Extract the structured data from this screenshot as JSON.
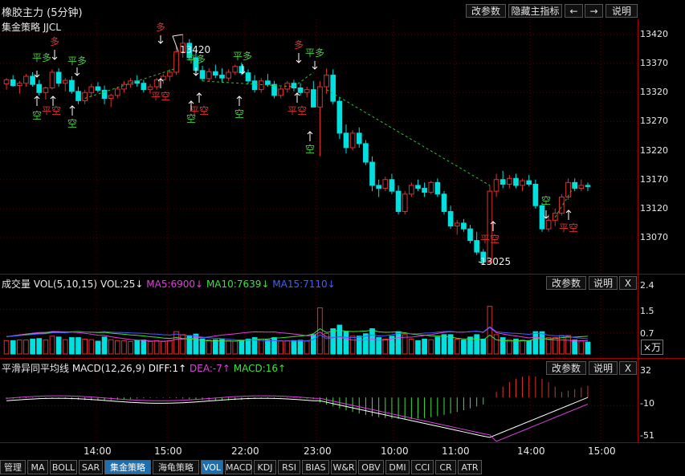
{
  "header": {
    "title": "橡胶主力 (5分钟)",
    "buttons": [
      "改参数",
      "隐藏主指标",
      "←",
      "→",
      "说明"
    ]
  },
  "main_panel": {
    "strategy_label": "集金策略 JJCL",
    "price_ticks": [
      "13420",
      "13370",
      "13320",
      "13270",
      "13220",
      "13170",
      "13120",
      "13070"
    ],
    "high_label": "13420",
    "low_label": "13025",
    "signals": {
      "long": "多",
      "close_long": "平多",
      "short": "空",
      "close_short": "平空"
    }
  },
  "volume_panel": {
    "name": "成交量 VOL(5,10,15)",
    "vol": "VOL:25↓",
    "ma5": "MA5:6900↓",
    "ma10": "MA10:7639↓",
    "ma15": "MA15:7110↓",
    "ticks": [
      "2.4",
      "1.5",
      "0.7"
    ],
    "unit": "×万",
    "buttons": [
      "改参数",
      "说明",
      "X"
    ]
  },
  "macd_panel": {
    "name": "平滑异同平均线 MACD(12,26,9)",
    "diff": "DIFF:1↑",
    "dea": "DEA:-7↑",
    "macd": "MACD:16↑",
    "ticks": [
      "32",
      "-10",
      "-51"
    ],
    "buttons": [
      "改参数",
      "说明",
      "X"
    ]
  },
  "time_axis": [
    "14:00",
    "15:00",
    "22:00",
    "23:00",
    "10:00",
    "11:00",
    "14:00",
    "15:00"
  ],
  "bottom_tabs": [
    "管理",
    "MA",
    "BOLL",
    "SAR",
    "集金策略",
    "海龟策略",
    "VOL",
    "MACD",
    "KDJ",
    "RSI",
    "BIAS",
    "W&R",
    "OBV",
    "DMI",
    "CCI",
    "CR",
    "ATR"
  ],
  "active_tabs": [
    "集金策略",
    "VOL"
  ],
  "colors": {
    "up": "#e03030",
    "down": "#00e0e0",
    "accent_tab": "#1e6fb0",
    "ma5": "#e040e0",
    "ma10": "#40e040",
    "ma15": "#4060ff",
    "diff": "#ffffff",
    "dea": "#e040e0",
    "signal_green": "#40d040",
    "signal_red": "#e03030"
  },
  "chart_data": {
    "type": "candlestick",
    "title": "橡胶主力 (5分钟)",
    "ylim": [
      13025,
      13420
    ],
    "candles": [
      [
        13335,
        13345,
        13325,
        13342
      ],
      [
        13342,
        13350,
        13330,
        13332
      ],
      [
        13332,
        13340,
        13318,
        13336
      ],
      [
        13336,
        13352,
        13330,
        13348
      ],
      [
        13348,
        13355,
        13330,
        13334
      ],
      [
        13334,
        13342,
        13315,
        13320
      ],
      [
        13320,
        13330,
        13308,
        13328
      ],
      [
        13328,
        13360,
        13325,
        13355
      ],
      [
        13355,
        13362,
        13330,
        13336
      ],
      [
        13336,
        13345,
        13322,
        13341
      ],
      [
        13341,
        13348,
        13318,
        13322
      ],
      [
        13322,
        13330,
        13300,
        13306
      ],
      [
        13306,
        13325,
        13300,
        13320
      ],
      [
        13320,
        13335,
        13312,
        13330
      ],
      [
        13330,
        13338,
        13320,
        13324
      ],
      [
        13324,
        13332,
        13300,
        13310
      ],
      [
        13310,
        13318,
        13295,
        13315
      ],
      [
        13315,
        13330,
        13310,
        13326
      ],
      [
        13326,
        13340,
        13320,
        13334
      ],
      [
        13334,
        13345,
        13328,
        13340
      ],
      [
        13340,
        13350,
        13330,
        13336
      ],
      [
        13336,
        13342,
        13320,
        13325
      ],
      [
        13325,
        13335,
        13318,
        13330
      ],
      [
        13330,
        13345,
        13325,
        13342
      ],
      [
        13342,
        13352,
        13335,
        13348
      ],
      [
        13348,
        13360,
        13340,
        13355
      ],
      [
        13355,
        13400,
        13350,
        13390
      ],
      [
        13390,
        13420,
        13380,
        13405
      ],
      [
        13405,
        13412,
        13375,
        13380
      ],
      [
        13380,
        13392,
        13350,
        13358
      ],
      [
        13358,
        13366,
        13340,
        13344
      ],
      [
        13344,
        13362,
        13340,
        13356
      ],
      [
        13356,
        13368,
        13345,
        13350
      ],
      [
        13350,
        13362,
        13338,
        13345
      ],
      [
        13345,
        13360,
        13340,
        13355
      ],
      [
        13355,
        13368,
        13350,
        13365
      ],
      [
        13365,
        13372,
        13350,
        13354
      ],
      [
        13354,
        13360,
        13335,
        13340
      ],
      [
        13340,
        13350,
        13320,
        13325
      ],
      [
        13325,
        13345,
        13320,
        13340
      ],
      [
        13340,
        13352,
        13330,
        13334
      ],
      [
        13334,
        13340,
        13310,
        13315
      ],
      [
        13315,
        13330,
        13310,
        13326
      ],
      [
        13326,
        13340,
        13320,
        13336
      ],
      [
        13336,
        13342,
        13322,
        13328
      ],
      [
        13328,
        13336,
        13315,
        13320
      ],
      [
        13320,
        13330,
        13312,
        13325
      ],
      [
        13325,
        13340,
        13300,
        13295
      ],
      [
        13295,
        13340,
        13210,
        13330
      ],
      [
        13330,
        13362,
        13318,
        13350
      ],
      [
        13350,
        13360,
        13300,
        13305
      ],
      [
        13305,
        13312,
        13240,
        13250
      ],
      [
        13250,
        13265,
        13215,
        13225
      ],
      [
        13225,
        13255,
        13220,
        13250
      ],
      [
        13250,
        13260,
        13225,
        13232
      ],
      [
        13232,
        13238,
        13195,
        13200
      ],
      [
        13200,
        13210,
        13150,
        13160
      ],
      [
        13160,
        13170,
        13140,
        13155
      ],
      [
        13155,
        13175,
        13150,
        13170
      ],
      [
        13170,
        13180,
        13145,
        13150
      ],
      [
        13150,
        13160,
        13110,
        13115
      ],
      [
        13115,
        13150,
        13110,
        13145
      ],
      [
        13145,
        13165,
        13140,
        13160
      ],
      [
        13160,
        13170,
        13150,
        13155
      ],
      [
        13155,
        13165,
        13140,
        13148
      ],
      [
        13148,
        13168,
        13145,
        13165
      ],
      [
        13165,
        13172,
        13140,
        13145
      ],
      [
        13145,
        13150,
        13110,
        13115
      ],
      [
        13115,
        13125,
        13085,
        13090
      ],
      [
        13090,
        13100,
        13075,
        13095
      ],
      [
        13095,
        13102,
        13080,
        13085
      ],
      [
        13085,
        13092,
        13060,
        13065
      ],
      [
        13065,
        13080,
        13040,
        13045
      ],
      [
        13045,
        13050,
        13025,
        13028
      ],
      [
        13028,
        13160,
        13025,
        13150
      ],
      [
        13150,
        13180,
        13140,
        13170
      ],
      [
        13170,
        13185,
        13155,
        13162
      ],
      [
        13162,
        13178,
        13155,
        13172
      ],
      [
        13172,
        13180,
        13155,
        13160
      ],
      [
        13160,
        13172,
        13150,
        13168
      ],
      [
        13168,
        13178,
        13158,
        13162
      ],
      [
        13162,
        13170,
        13120,
        13125
      ],
      [
        13125,
        13130,
        13080,
        13085
      ],
      [
        13085,
        13110,
        13080,
        13100
      ],
      [
        13100,
        13120,
        13090,
        13112
      ],
      [
        13112,
        13145,
        13108,
        13140
      ],
      [
        13140,
        13172,
        13135,
        13165
      ],
      [
        13165,
        13172,
        13150,
        13155
      ],
      [
        13155,
        13170,
        13150,
        13160
      ],
      [
        13160,
        13165,
        13150,
        13158
      ]
    ],
    "volume_ylim": [
      0,
      2.4
    ],
    "volume_ticks": [
      2.4,
      1.5,
      0.7
    ],
    "macd_ylim": [
      -51,
      32
    ],
    "macd_ticks": [
      32,
      -10,
      -51
    ]
  }
}
